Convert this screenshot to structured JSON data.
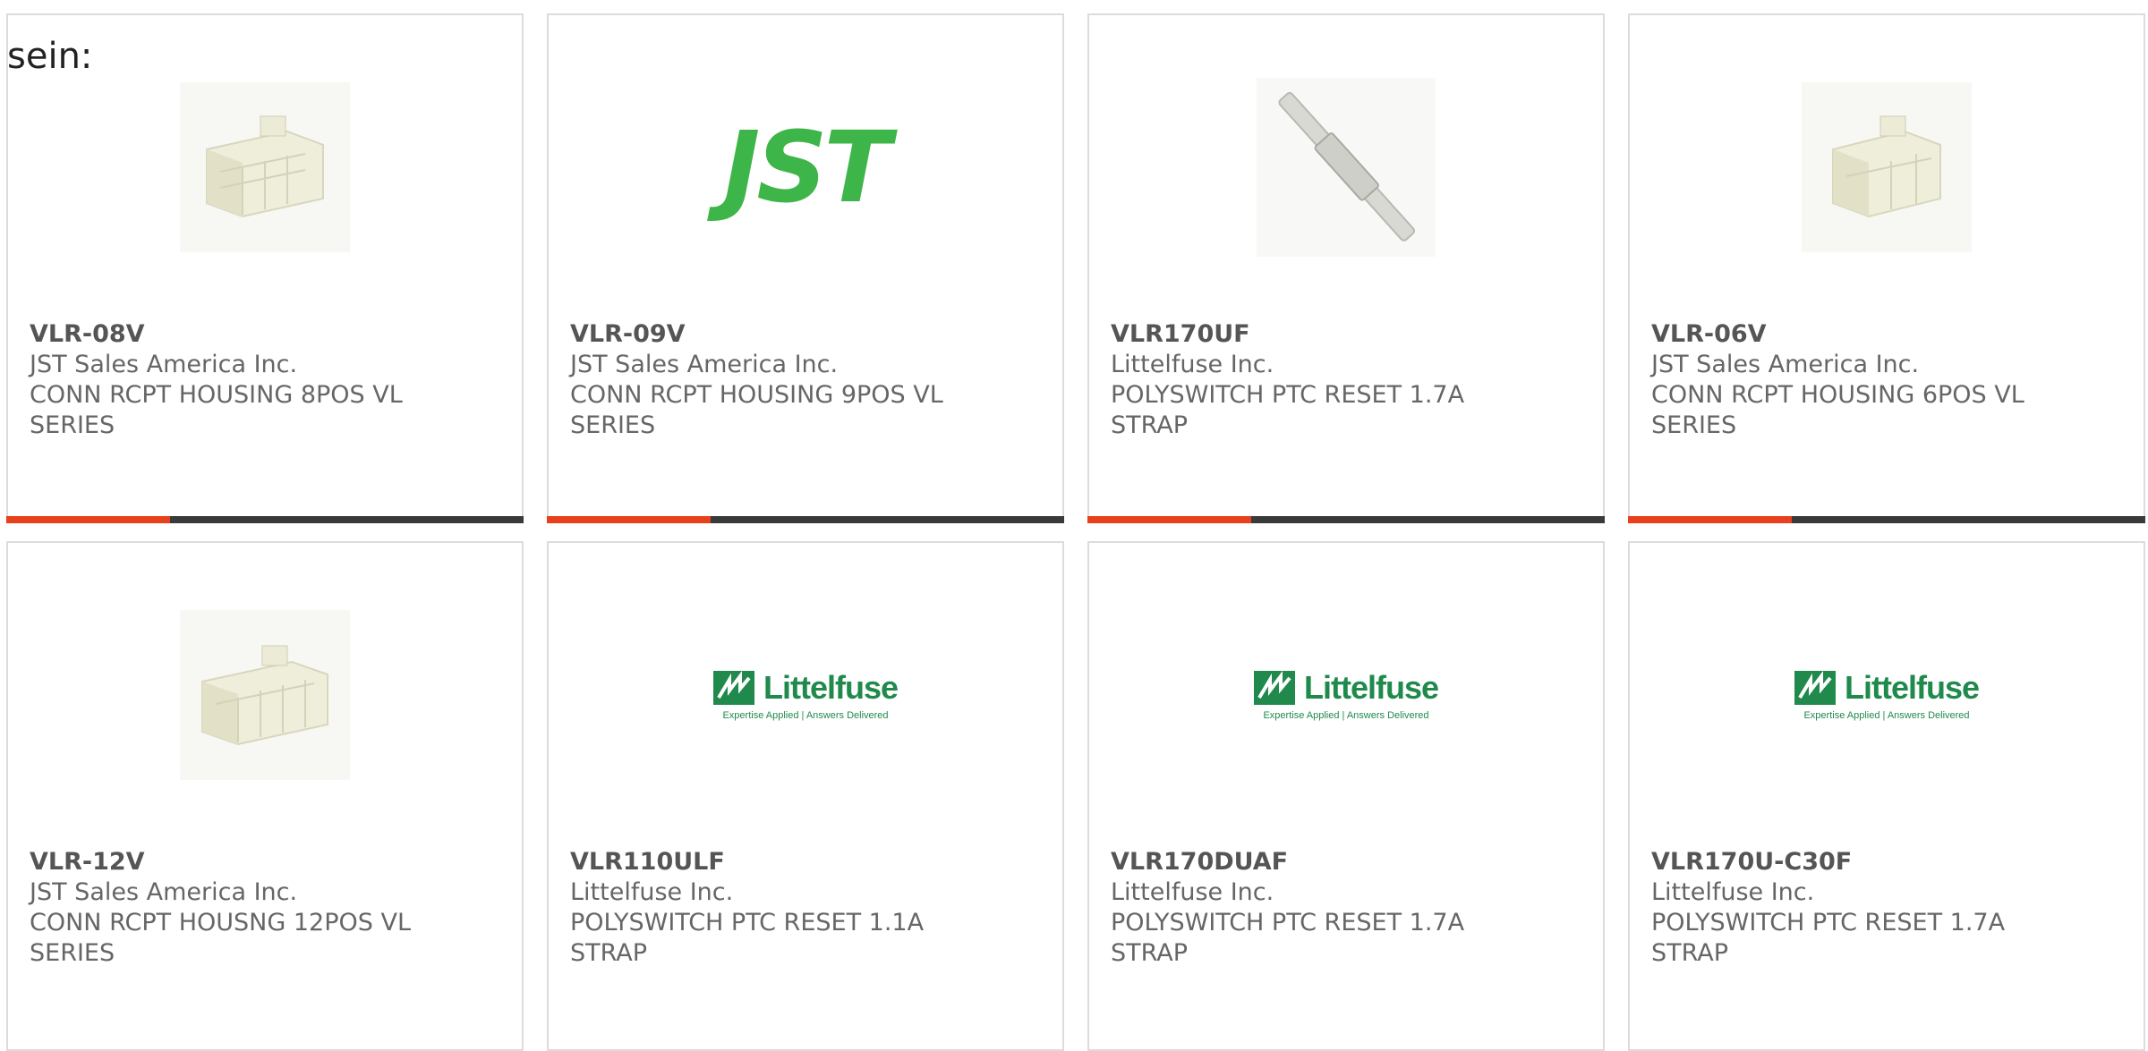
{
  "page": {
    "label": "sein:"
  },
  "colors": {
    "accent_bar": "#e8401c",
    "bar_track": "#3a3a3a",
    "jst_green": "#3eb549",
    "littelfuse_green": "#1f8a4c"
  },
  "products": [
    {
      "part_number": "VLR-08V",
      "manufacturer": "JST Sales America Inc.",
      "description_line1": "CONN RCPT HOUSING 8POS VL",
      "description_line2": "SERIES",
      "image": "connector-housing-image"
    },
    {
      "part_number": "VLR-09V",
      "manufacturer": "JST Sales America Inc.",
      "description_line1": "CONN RCPT HOUSING 9POS VL",
      "description_line2": "SERIES",
      "image": "jst-logo",
      "logo_text": "JST"
    },
    {
      "part_number": "VLR170UF",
      "manufacturer": "Littelfuse Inc.",
      "description_line1": "POLYSWITCH PTC RESET 1.7A",
      "description_line2": "STRAP",
      "image": "ptc-strap-image"
    },
    {
      "part_number": "VLR-06V",
      "manufacturer": "JST Sales America Inc.",
      "description_line1": "CONN RCPT HOUSING 6POS VL",
      "description_line2": "SERIES",
      "image": "connector-housing-image"
    },
    {
      "part_number": "VLR-12V",
      "manufacturer": "JST Sales America Inc.",
      "description_line1": "CONN RCPT HOUSNG 12POS VL",
      "description_line2": "SERIES",
      "image": "connector-housing-image"
    },
    {
      "part_number": "VLR110ULF",
      "manufacturer": "Littelfuse Inc.",
      "description_line1": "POLYSWITCH PTC RESET 1.1A",
      "description_line2": "STRAP",
      "image": "littelfuse-logo",
      "logo_text": "Littelfuse",
      "logo_tagline": "Expertise Applied | Answers Delivered"
    },
    {
      "part_number": "VLR170DUAF",
      "manufacturer": "Littelfuse Inc.",
      "description_line1": "POLYSWITCH PTC RESET 1.7A",
      "description_line2": "STRAP",
      "image": "littelfuse-logo",
      "logo_text": "Littelfuse",
      "logo_tagline": "Expertise Applied | Answers Delivered"
    },
    {
      "part_number": "VLR170U-C30F",
      "manufacturer": "Littelfuse Inc.",
      "description_line1": "POLYSWITCH PTC RESET 1.7A",
      "description_line2": "STRAP",
      "image": "littelfuse-logo",
      "logo_text": "Littelfuse",
      "logo_tagline": "Expertise Applied | Answers Delivered"
    }
  ]
}
